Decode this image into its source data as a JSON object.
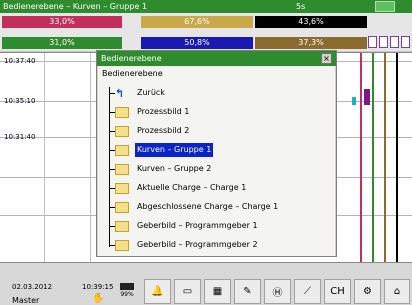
{
  "title": "Bedienerebene – Kurven – Gruppe 1",
  "title_time": "5s",
  "values": {
    "row1": [
      {
        "text": "33,0%",
        "color": "#c0305a"
      },
      {
        "text": "67,6%",
        "color": "#c8a848"
      },
      {
        "text": "43,6%",
        "color": "#000000"
      }
    ],
    "row2": [
      {
        "text": "31,0%",
        "color": "#2e8b2e"
      },
      {
        "text": "50,8%",
        "color": "#1a1ab0"
      },
      {
        "text": "37,3%",
        "color": "#8b6b2e"
      }
    ]
  },
  "chart": {
    "time_labels": [
      "10:37:40",
      "10:35:10",
      "10:31:40"
    ]
  },
  "dialog": {
    "title": "Bedienerebene",
    "close": "×",
    "heading": "Bedienerebene",
    "items": [
      {
        "label": "Zurück",
        "icon": "back-arrow-icon"
      },
      {
        "label": "Prozessbild 1",
        "icon": "folder-icon"
      },
      {
        "label": "Prozessbild 2",
        "icon": "folder-icon"
      },
      {
        "label": "Kurven – Gruppe 1",
        "icon": "folder-icon",
        "selected": true
      },
      {
        "label": "Kurven – Gruppe 2",
        "icon": "folder-icon"
      },
      {
        "label": "Aktuelle Charge – Charge 1",
        "icon": "folder-icon"
      },
      {
        "label": "Abgeschlossene Charge – Charge 1",
        "icon": "folder-icon"
      },
      {
        "label": "Geberbild – Programmgeber 1",
        "icon": "folder-icon"
      },
      {
        "label": "Geberbild – Programmgeber 2",
        "icon": "folder-icon"
      }
    ]
  },
  "bottom": {
    "date": "02.03.2012",
    "time": "10:39:15",
    "user": "Master",
    "memory": "99%",
    "buttons": [
      "bell-icon",
      "display-icon",
      "calendar-icon",
      "edit-icon",
      "hold-icon",
      "probe-icon",
      "ch-icon",
      "settings-icon",
      "home-icon"
    ]
  }
}
